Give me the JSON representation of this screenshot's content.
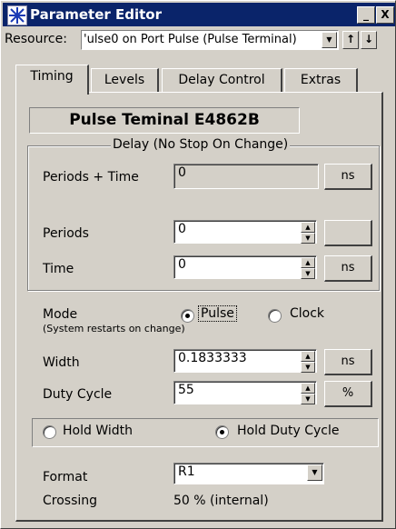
{
  "window": {
    "title": "Parameter Editor",
    "minimize": "_",
    "close": "X"
  },
  "resource": {
    "label": "Resource:",
    "value": "'ulse0 on Port Pulse (Pulse Terminal)",
    "up": "↑",
    "down": "↓"
  },
  "tabs": [
    {
      "label": "Timing",
      "active": true
    },
    {
      "label": "Levels",
      "active": false
    },
    {
      "label": "Delay Control",
      "active": false
    },
    {
      "label": "Extras",
      "active": false
    }
  ],
  "device_title": "Pulse Teminal E4862B",
  "delay_group": {
    "title": "Delay (No Stop On Change)",
    "periods_time": {
      "label": "Periods + Time",
      "value": "0",
      "unit": "ns"
    },
    "periods": {
      "label": "Periods",
      "value": "0",
      "unit": ""
    },
    "time": {
      "label": "Time",
      "value": "0",
      "unit": "ns"
    }
  },
  "mode": {
    "label": "Mode",
    "note": "(System restarts on change)",
    "options": [
      {
        "label": "Pulse",
        "selected": true
      },
      {
        "label": "Clock",
        "selected": false
      }
    ]
  },
  "width": {
    "label": "Width",
    "value": "0.1833333",
    "unit": "ns"
  },
  "duty_cycle": {
    "label": "Duty Cycle",
    "value": "55",
    "unit": "%"
  },
  "hold": {
    "options": [
      {
        "label": "Hold Width",
        "selected": false
      },
      {
        "label": "Hold Duty Cycle",
        "selected": true
      }
    ]
  },
  "format": {
    "label": "Format",
    "value": "R1"
  },
  "crossing": {
    "label": "Crossing",
    "value": "50 % (internal)"
  },
  "colors": {
    "titlebar": "#0a246a",
    "face": "#d4d0c8"
  }
}
